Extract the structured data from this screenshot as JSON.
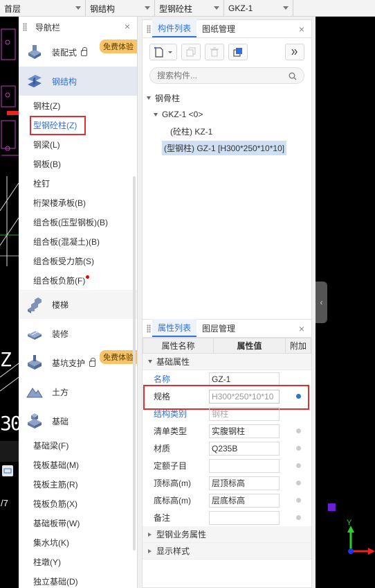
{
  "topbar": {
    "floor": "首层",
    "category": "钢结构",
    "type": "型钢砼柱",
    "item": "GKZ-1"
  },
  "cad": {
    "left_labels": [
      "Z",
      "30",
      "/7"
    ],
    "axis_label": "Y"
  },
  "nav": {
    "title": "导航栏",
    "categories_top": [
      {
        "label": "装配式",
        "badge": "免费体验"
      },
      {
        "label": "钢结构"
      }
    ],
    "steel_items": [
      "钢柱(Z)",
      "型钢砼柱(Z)",
      "钢梁(L)",
      "钢板(B)",
      "栓钉",
      "桁架楼承板(B)",
      "组合板(压型钢板)(B)",
      "组合板(混凝土)(B)",
      "组合板受力筋(S)",
      "组合板负筋(F)"
    ],
    "categories_bottom": [
      {
        "label": "楼梯"
      },
      {
        "label": "装修"
      },
      {
        "label": "基坑支护",
        "badge": "免费体验"
      },
      {
        "label": "土方"
      },
      {
        "label": "基础"
      }
    ],
    "foundation_items": [
      "基础梁(F)",
      "筏板基础(M)",
      "筏板主筋(R)",
      "筏板负筋(X)",
      "基础板带(W)",
      "集水坑(K)",
      "柱墩(Y)",
      "独立基础(D)"
    ]
  },
  "components": {
    "tabs": [
      "构件列表",
      "图纸管理"
    ],
    "search_placeholder": "搜索构件...",
    "tree": {
      "root": "钢骨柱",
      "child": "GKZ-1 <0>",
      "leaves": [
        "(砼柱) KZ-1",
        "(型钢柱) GZ-1 [H300*250*10*10]"
      ]
    }
  },
  "properties": {
    "tabs": [
      "属性列表",
      "图层管理"
    ],
    "headers": [
      "属性名称",
      "属性值",
      "附加"
    ],
    "group_basic": "基础属性",
    "rows": [
      {
        "name": "名称",
        "value": "GZ-1"
      },
      {
        "name": "规格",
        "value": "H300*250*10*10"
      },
      {
        "name": "结构类别",
        "value": "钢柱"
      },
      {
        "name": "清单类型",
        "value": "实腹钢柱"
      },
      {
        "name": "材质",
        "value": "Q235B"
      },
      {
        "name": "定额子目",
        "value": ""
      },
      {
        "name": "顶标高(m)",
        "value": "层顶标高"
      },
      {
        "name": "底标高(m)",
        "value": "层底标高"
      },
      {
        "name": "备注",
        "value": ""
      }
    ],
    "group_business": "型钢业务属性",
    "group_display": "显示样式"
  },
  "colors": {
    "accent": "#2f6fde",
    "highlight_red": "#e12d2d",
    "badge": "#f7c46a",
    "selected_bg": "#e4e8f0"
  }
}
